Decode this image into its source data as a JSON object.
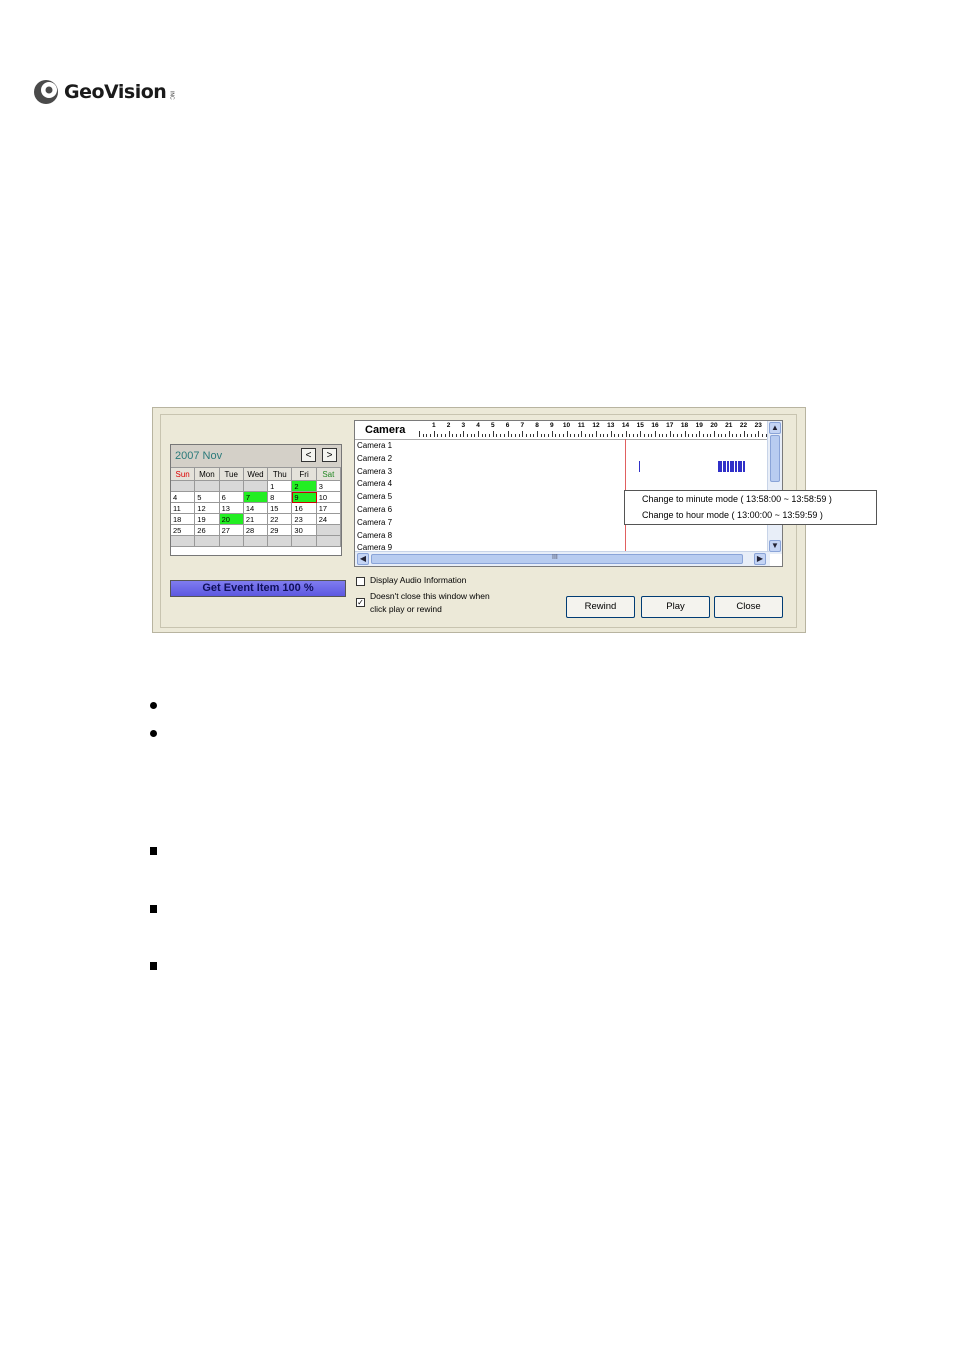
{
  "logo": {
    "text": "GeoVision",
    "tm": "INC"
  },
  "calendar": {
    "title": "2007  Nov",
    "prev": "<",
    "next": ">",
    "weekdays": [
      "Sun",
      "Mon",
      "Tue",
      "Wed",
      "Thu",
      "Fri",
      "Sat"
    ],
    "weeks": [
      [
        "",
        "",
        "",
        "",
        "1",
        "2",
        "3"
      ],
      [
        "4",
        "5",
        "6",
        "7",
        "8",
        "9",
        "10"
      ],
      [
        "11",
        "12",
        "13",
        "14",
        "15",
        "16",
        "17"
      ],
      [
        "18",
        "19",
        "20",
        "21",
        "22",
        "23",
        "24"
      ],
      [
        "25",
        "26",
        "27",
        "28",
        "29",
        "30",
        ""
      ],
      [
        "",
        "",
        "",
        "",
        "",
        "",
        ""
      ]
    ],
    "event_days": [
      "2",
      "7",
      "9",
      "20"
    ],
    "selected_day": "9",
    "colors": {
      "sun": "#dd0000",
      "sat": "#228822",
      "event": "#22ee22"
    }
  },
  "progress": {
    "label": "Get Event Item 100 %"
  },
  "timeline": {
    "header": "Camera",
    "hours": [
      "1",
      "2",
      "3",
      "4",
      "5",
      "6",
      "7",
      "8",
      "9",
      "10",
      "11",
      "12",
      "13",
      "14",
      "15",
      "16",
      "17",
      "18",
      "19",
      "20",
      "21",
      "22",
      "23"
    ],
    "cameras": [
      "Camera 1",
      "Camera 2",
      "Camera 3",
      "Camera 4",
      "Camera 5",
      "Camera 6",
      "Camera 7",
      "Camera 8",
      "Camera 9"
    ],
    "hscroll_grip": "III"
  },
  "context_menu": {
    "minute_mode": "Change to minute mode ( 13:58:00 ~ 13:58:59 )",
    "hour_mode": "Change to hour mode ( 13:00:00 ~ 13:59:59 )"
  },
  "options": {
    "audio": {
      "label": "Display Audio Information",
      "checked": false
    },
    "keep_open": {
      "label_line1": "Doesn't close this window when",
      "label_line2": "click play or rewind",
      "checked": true
    }
  },
  "buttons": {
    "rewind": "Rewind",
    "play": "Play",
    "close": "Close"
  },
  "bullets": {
    "dots": 2,
    "squares": 3
  }
}
